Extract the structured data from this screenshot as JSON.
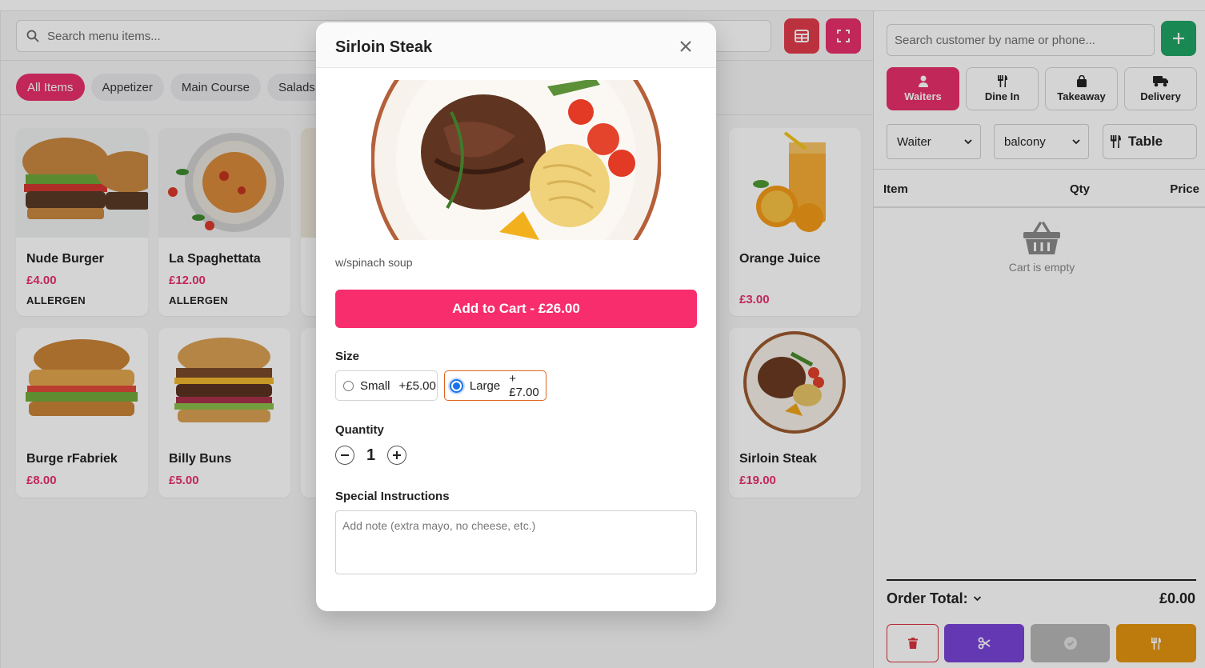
{
  "menu": {
    "search_placeholder": "Search menu items...",
    "categories": [
      "All Items",
      "Appetizer",
      "Main Course",
      "Salads"
    ],
    "active_category": "All Items",
    "items": [
      {
        "name": "Nude Burger",
        "price": "£4.00",
        "allergen": "ALLERGEN"
      },
      {
        "name": "La Spaghettata",
        "price": "£12.00",
        "allergen": "ALLERGEN"
      },
      {
        "name": "Orange Juice",
        "price": "£3.00"
      },
      {
        "name": "Burge rFabriek",
        "price": "£8.00"
      },
      {
        "name": "Billy Buns",
        "price": "£5.00"
      },
      {
        "name": "Sirloin Steak",
        "price": "£19.00"
      }
    ]
  },
  "modal": {
    "title": "Sirloin Steak",
    "description": "w/spinach soup",
    "add_to_cart": "Add to Cart - £26.00",
    "size_label": "Size",
    "sizes": [
      {
        "label": "Small",
        "price": "+£5.00",
        "selected": false
      },
      {
        "label": "Large",
        "price": "+£7.00",
        "selected": true
      }
    ],
    "quantity_label": "Quantity",
    "quantity": "1",
    "instructions_label": "Special Instructions",
    "instructions_placeholder": "Add note (extra mayo, no cheese, etc.)"
  },
  "order": {
    "customer_search_placeholder": "Search customer by name or phone...",
    "order_types": [
      "Waiters",
      "Dine In",
      "Takeaway",
      "Delivery"
    ],
    "active_order_type": "Waiters",
    "waiter_select": "Waiter",
    "area_select": "balcony",
    "table_label": "Table",
    "columns": {
      "item": "Item",
      "qty": "Qty",
      "price": "Price"
    },
    "empty_text": "Cart is empty",
    "total_label": "Order Total:",
    "total_value": "£0.00"
  },
  "colors": {
    "accent_pink": "#e8306b",
    "add_cart_pink": "#f72d6d",
    "grid_red": "#e23b4b",
    "add_green": "#20a464",
    "split_purple": "#7a44d8",
    "complete_gray": "#b6b6b6",
    "serve_orange": "#e59410"
  }
}
